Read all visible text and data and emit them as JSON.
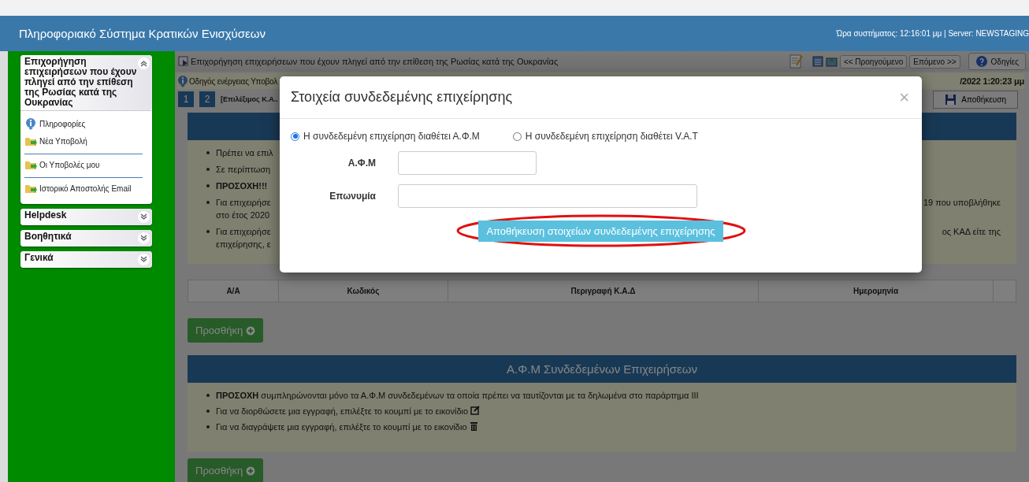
{
  "header": {
    "title": "Πληροφοριακό Σύστημα Κρατικών Ενισχύσεων",
    "status": "Ώρα συστήματος: 12:16:01 μμ | Server: NEWSTAGING"
  },
  "sidebar": {
    "sections": [
      {
        "title": "Επιχορήγηση επιχειρήσεων που έχουν πληγεί από την επίθεση της Ρωσίας κατά της Ουκρανίας",
        "expanded": true,
        "items": [
          {
            "label": "Πληροφορίες",
            "kind": "info"
          },
          {
            "label": "Νέα Υποβολή",
            "kind": "folder"
          },
          {
            "label": "Οι Υποβολές μου",
            "kind": "folder"
          },
          {
            "label": "Ιστορικό Αποστολής Email",
            "kind": "folder"
          }
        ]
      },
      {
        "title": "Helpdesk",
        "expanded": false
      },
      {
        "title": "Βοηθητικά",
        "expanded": false
      },
      {
        "title": "Γενικά",
        "expanded": false
      }
    ]
  },
  "toolbar": {
    "breadcrumb": "Επιχορήγηση επιχειρήσεων που έχουν πληγεί από την επίθεση της Ρωσίας κατά της Ουκρανίας",
    "buttons": [
      {
        "label": "<< Προηγούμενο",
        "kind": "nav"
      },
      {
        "label": "Επόμενο >>",
        "kind": "nav"
      },
      {
        "label": "Οδηγίες",
        "kind": "help"
      }
    ]
  },
  "info_bar": {
    "text": "Οδηγός ενέργειας Υποβολ",
    "timestamp": "/2022 1:20:23 μμ"
  },
  "steps": {
    "items": [
      {
        "label": "1"
      },
      {
        "label": "2"
      }
    ],
    "current": "[Επιλέξιμος Κ.Α..",
    "save_button": "Αποθήκευση"
  },
  "panel_1": {
    "bullets": [
      {
        "left": [
          "Πρέπει να επιλ"
        ],
        "bold": false
      },
      {
        "left": [
          "Σε περίπτωση"
        ],
        "bold": false
      },
      {
        "left": [
          "ΠΡΟΣΟΧΗ!!!"
        ],
        "bold": true
      },
      {
        "left": [
          "Για επιχειρήσε",
          "στο έτος 2020"
        ],
        "right": "19 που υποβλήθηκε",
        "bold": false
      },
      {
        "left": [
          "Για επιχειρήσε",
          "επιχείρησης, ε"
        ],
        "right": "ος ΚΑΔ είτε της",
        "bold": false
      }
    ]
  },
  "table": {
    "columns": [
      "Α/Α",
      "Κωδικός",
      "Περιγραφή Κ.Α.Δ",
      "Ημερομηνία"
    ]
  },
  "add_button_1": "Προσθήκη",
  "panel_2": {
    "title": "Α.Φ.Μ Συνδεδεμένων Επιχειρήσεων",
    "bullets": [
      {
        "text": "**ΠΡΟΣΟΧΗ** συμπληρώνονται μόνο τα Α.Φ.Μ συνδεδεμένων τα οποία πρέπει να ταυτίζονται με τα δηλωμένα στο παράρτημα ΙΙΙ"
      },
      {
        "text": "Για να διορθώσετε μια εγγραφή, επιλέξτε το κουμπί με το εικονίδιο",
        "kind": "edit"
      },
      {
        "text": "Για να διαγράψετε μια εγγραφή, επιλέξτε το κουμπί με το εικονίδιο",
        "kind": "trash"
      }
    ]
  },
  "add_button_2": "Προσθήκη",
  "modal": {
    "title": "Στοιχεία συνδεδεμένης επιχείρησης",
    "close": "×",
    "radios": [
      {
        "label": "Η συνδεδεμένη επιχείρηση διαθέτει Α.Φ.Μ",
        "selected": true
      },
      {
        "label": "Η συνδεδεμένη επιχείρηση διαθέτει V.A.T",
        "selected": false
      }
    ],
    "fields": [
      {
        "label": "Α.Φ.Μ",
        "kind": "short"
      },
      {
        "label": "Επωνυμία",
        "kind": "wide"
      }
    ],
    "submit": "Αποθήκευση στοιχείων συνδεδεμένης επιχείρησης",
    "highlighted": true
  }
}
